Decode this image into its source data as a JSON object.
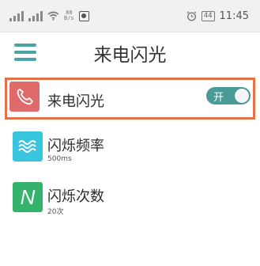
{
  "status_bar": {
    "speed_value": "80",
    "speed_unit": "B/s",
    "battery": "44",
    "time": "11:45"
  },
  "header": {
    "title": "来电闪光"
  },
  "settings": [
    {
      "label": "来电闪光",
      "icon": "phone-icon",
      "color": "#e06a6a",
      "toggle_label": "开",
      "toggle_on": true
    },
    {
      "label": "闪烁频率",
      "sub": "500ms",
      "icon": "wave-icon",
      "color": "#37c6de"
    },
    {
      "label": "闪烁次数",
      "sub": "20次",
      "icon": "N",
      "color": "#33b36b"
    }
  ]
}
